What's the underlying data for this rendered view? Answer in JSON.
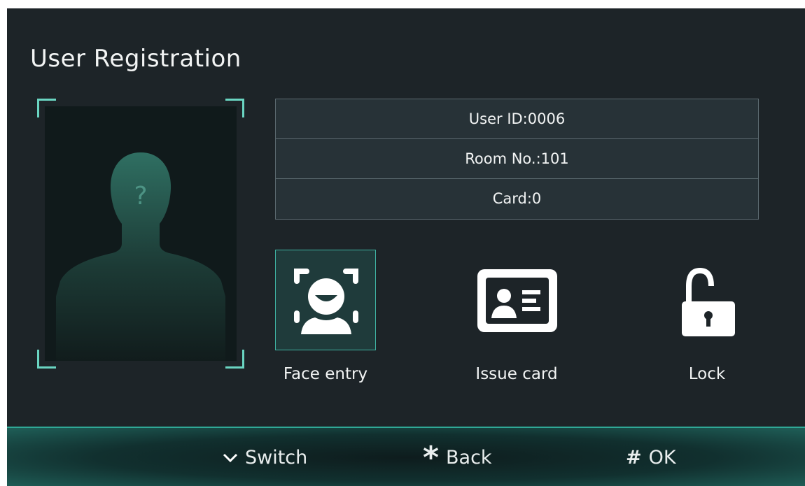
{
  "title": "User Registration",
  "info": {
    "user_id": "User ID:0006",
    "room_no": "Room No.:101",
    "card": "Card:0"
  },
  "actions": [
    {
      "label": "Face entry",
      "icon": "face-scan-icon",
      "active": true
    },
    {
      "label": "Issue card",
      "icon": "id-card-icon",
      "active": false
    },
    {
      "label": "Lock",
      "icon": "unlock-icon",
      "active": false
    }
  ],
  "photo": {
    "placeholder_mark": "?"
  },
  "bottom_bar": [
    {
      "key_icon": "chevron-down-icon",
      "label": "Switch"
    },
    {
      "key_icon": "asterisk-icon",
      "key": "*",
      "label": "Back"
    },
    {
      "key_icon": "hash-icon",
      "key": "#",
      "label": "OK"
    }
  ],
  "colors": {
    "background": "#1d2428",
    "accent": "#3fb3a2",
    "text": "#f2f4f4"
  }
}
